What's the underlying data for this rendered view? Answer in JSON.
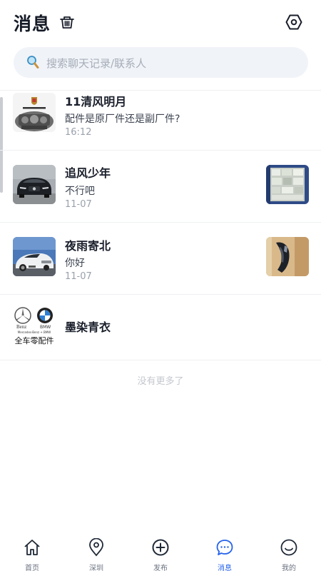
{
  "header": {
    "title": "消息",
    "clear_icon": "basket-clear-icon",
    "settings_icon": "hex-settings-icon"
  },
  "search": {
    "placeholder": "搜索聊天记录/联系人",
    "icon": "search-icon"
  },
  "conversations": [
    {
      "name": "11清风明月",
      "message": "配件是原厂件还是副厂件?",
      "time": "16:12",
      "avatar": "porsche-engine-photo"
    },
    {
      "name": "追风少年",
      "message": "不行吧",
      "time": "11-07",
      "avatar": "black-mercedes-photo",
      "thumbnail": "parts-box-photo"
    },
    {
      "name": "夜雨寄北",
      "message": "你好",
      "time": "11-07",
      "avatar": "white-audi-photo",
      "thumbnail": "headlight-photo"
    },
    {
      "name": "墨染青衣",
      "message": "",
      "time": "",
      "avatar": "benz-bmw-logo",
      "avatar_text": {
        "left": "Benz",
        "right": "BMW",
        "small": "Mercedes-Benz + BMW",
        "main": "全车零配件"
      }
    }
  ],
  "footer_note": "没有更多了",
  "tabbar": {
    "items": [
      {
        "label": "首页",
        "icon": "home-icon",
        "active": false
      },
      {
        "label": "深圳",
        "icon": "location-pin-icon",
        "active": false
      },
      {
        "label": "发布",
        "icon": "add-circle-icon",
        "active": false
      },
      {
        "label": "消息",
        "icon": "chat-bubble-icon",
        "active": true
      },
      {
        "label": "我的",
        "icon": "smile-face-icon",
        "active": false
      }
    ],
    "active_color": "#2563eb"
  }
}
